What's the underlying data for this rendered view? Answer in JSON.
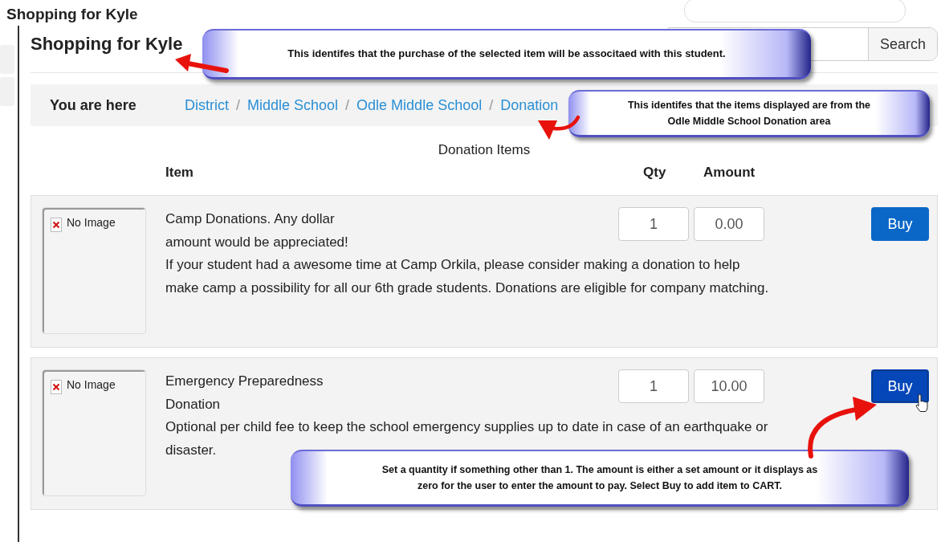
{
  "background": {
    "title": "Shopping for Kyle"
  },
  "header": {
    "title": "Shopping for Kyle",
    "search_button": "Search"
  },
  "breadcrumb": {
    "label": "You are here",
    "separator": "/",
    "links": [
      "District",
      "Middle School",
      "Odle Middle School",
      "Donation"
    ]
  },
  "section_title": "Donation Items",
  "columns": [
    "Item",
    "Qty",
    "Amount"
  ],
  "items": [
    {
      "image_placeholder": "No Image",
      "title_lines": [
        "Camp Donations. Any dollar",
        "amount would be appreciated!"
      ],
      "description_lines": [
        "If your student had a awesome time at Camp Orkila, please consider making a donation to help",
        "make camp a possibility for all our 6th grade students. Donations are eligible for company matching."
      ],
      "qty": "1",
      "amount": "0.00",
      "buy_label": "Buy",
      "hovered": false
    },
    {
      "image_placeholder": "No Image",
      "title_lines": [
        "Emergency Preparedness",
        "Donation"
      ],
      "description_lines": [
        "Optional per child fee to keep the school emergency supplies up to date in case of an earthquake or",
        "disaster."
      ],
      "qty": "1",
      "amount": "10.00",
      "buy_label": "Buy",
      "hovered": true
    }
  ],
  "callouts": [
    {
      "lines": [
        "This identifes that the purchase of the selected item will be associtaed with this student."
      ]
    },
    {
      "lines": [
        "This identifes that the items displayed are from the",
        "Odle Middle School Donation area"
      ]
    },
    {
      "lines": [
        "Set a quantity if something other than 1.  The amount is either a set amount or it displays as",
        "zero for the user to enter the amount to pay.  Select Buy to add item to CART."
      ]
    }
  ]
}
